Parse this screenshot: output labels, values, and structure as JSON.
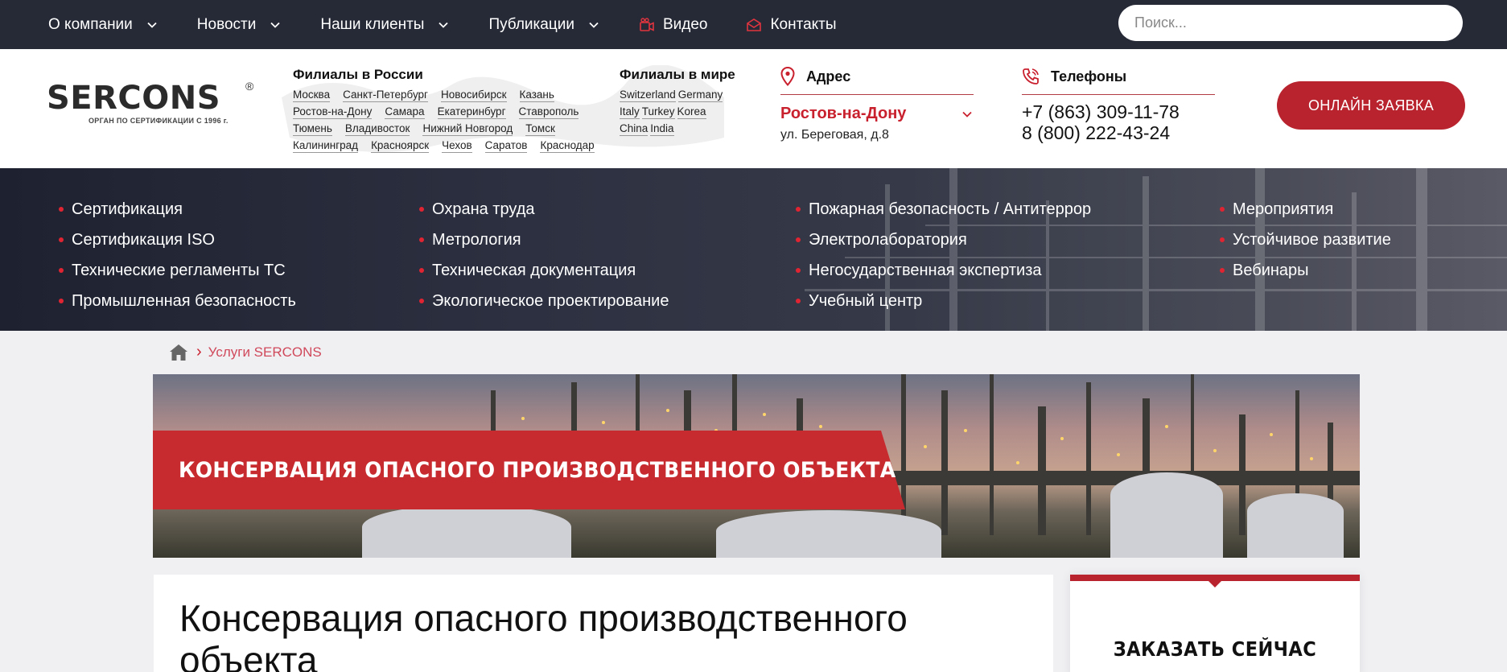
{
  "topbar": {
    "items": [
      {
        "label": "О компании"
      },
      {
        "label": "Новости"
      },
      {
        "label": "Наши клиенты"
      },
      {
        "label": "Публикации"
      },
      {
        "label": "Видео"
      },
      {
        "label": "Контакты"
      }
    ],
    "search_placeholder": "Поиск..."
  },
  "logo": {
    "name": "SERCONS",
    "tagline": "ОРГАН ПО СЕРТИФИКАЦИИ С 1996 г.",
    "reg": "®"
  },
  "branches_russia": {
    "title": "Филиалы в России",
    "rows": [
      [
        "Москва",
        "Санкт-Петербург",
        "Новосибирск",
        "Казань"
      ],
      [
        "Ростов-на-Дону",
        "Самара",
        "Екатеринбург",
        "Ставрополь"
      ],
      [
        "Тюмень",
        "Владивосток",
        "Нижний Новгород",
        "Томск"
      ],
      [
        "Калининград",
        "Красноярск",
        "Чехов",
        "Саратов",
        "Краснодар"
      ]
    ]
  },
  "branches_world": {
    "title": "Филиалы в мире",
    "rows": [
      [
        "Switzerland",
        "Germany"
      ],
      [
        "Italy",
        "Turkey",
        "Korea"
      ],
      [
        "China",
        "India"
      ]
    ]
  },
  "address": {
    "label": "Адрес",
    "city": "Ростов-на-Дону",
    "street": "ул. Береговая, д.8"
  },
  "phones": {
    "label": "Телефоны",
    "phone1": "+7 (863) 309-11-78",
    "phone2": "8 (800) 222-43-24"
  },
  "cta_label": "ОНЛАЙН ЗАЯВКА",
  "services": {
    "col1": [
      "Сертификация",
      "Сертификация ISO",
      "Технические регламенты ТС",
      "Промышленная безопасность"
    ],
    "col2": [
      "Охрана труда",
      "Метрология",
      "Техническая документация",
      "Экологическое проектирование"
    ],
    "col3": [
      "Пожарная безопасность / Антитеррор",
      "Электролаборатория",
      "Негосударственная экспертиза",
      "Учебный центр"
    ],
    "col4": [
      "Мероприятия",
      "Устойчивое развитие",
      "Вебинары"
    ]
  },
  "breadcrumb": {
    "current": "Услуги SERCONS"
  },
  "banner_title": "КОНСЕРВАЦИЯ ОПАСНОГО ПРОИЗВОДСТВЕННОГО ОБЪЕКТА",
  "page_title": "Консервация опасного производственного объекта",
  "aside_title": "ЗАКАЗАТЬ СЕЙЧАС",
  "colors": {
    "topbar_bg": "#262a37",
    "accent": "#b8232e",
    "accent_text": "#c9202e"
  }
}
